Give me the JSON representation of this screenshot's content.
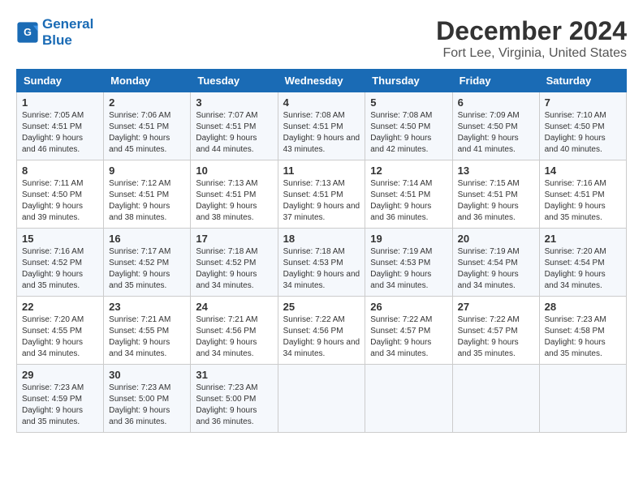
{
  "logo": {
    "line1": "General",
    "line2": "Blue"
  },
  "title": "December 2024",
  "location": "Fort Lee, Virginia, United States",
  "headers": [
    "Sunday",
    "Monday",
    "Tuesday",
    "Wednesday",
    "Thursday",
    "Friday",
    "Saturday"
  ],
  "weeks": [
    [
      {
        "day": "1",
        "sunrise": "7:05 AM",
        "sunset": "4:51 PM",
        "daylight": "9 hours and 46 minutes."
      },
      {
        "day": "2",
        "sunrise": "7:06 AM",
        "sunset": "4:51 PM",
        "daylight": "9 hours and 45 minutes."
      },
      {
        "day": "3",
        "sunrise": "7:07 AM",
        "sunset": "4:51 PM",
        "daylight": "9 hours and 44 minutes."
      },
      {
        "day": "4",
        "sunrise": "7:08 AM",
        "sunset": "4:51 PM",
        "daylight": "9 hours and 43 minutes."
      },
      {
        "day": "5",
        "sunrise": "7:08 AM",
        "sunset": "4:50 PM",
        "daylight": "9 hours and 42 minutes."
      },
      {
        "day": "6",
        "sunrise": "7:09 AM",
        "sunset": "4:50 PM",
        "daylight": "9 hours and 41 minutes."
      },
      {
        "day": "7",
        "sunrise": "7:10 AM",
        "sunset": "4:50 PM",
        "daylight": "9 hours and 40 minutes."
      }
    ],
    [
      {
        "day": "8",
        "sunrise": "7:11 AM",
        "sunset": "4:50 PM",
        "daylight": "9 hours and 39 minutes."
      },
      {
        "day": "9",
        "sunrise": "7:12 AM",
        "sunset": "4:51 PM",
        "daylight": "9 hours and 38 minutes."
      },
      {
        "day": "10",
        "sunrise": "7:13 AM",
        "sunset": "4:51 PM",
        "daylight": "9 hours and 38 minutes."
      },
      {
        "day": "11",
        "sunrise": "7:13 AM",
        "sunset": "4:51 PM",
        "daylight": "9 hours and 37 minutes."
      },
      {
        "day": "12",
        "sunrise": "7:14 AM",
        "sunset": "4:51 PM",
        "daylight": "9 hours and 36 minutes."
      },
      {
        "day": "13",
        "sunrise": "7:15 AM",
        "sunset": "4:51 PM",
        "daylight": "9 hours and 36 minutes."
      },
      {
        "day": "14",
        "sunrise": "7:16 AM",
        "sunset": "4:51 PM",
        "daylight": "9 hours and 35 minutes."
      }
    ],
    [
      {
        "day": "15",
        "sunrise": "7:16 AM",
        "sunset": "4:52 PM",
        "daylight": "9 hours and 35 minutes."
      },
      {
        "day": "16",
        "sunrise": "7:17 AM",
        "sunset": "4:52 PM",
        "daylight": "9 hours and 35 minutes."
      },
      {
        "day": "17",
        "sunrise": "7:18 AM",
        "sunset": "4:52 PM",
        "daylight": "9 hours and 34 minutes."
      },
      {
        "day": "18",
        "sunrise": "7:18 AM",
        "sunset": "4:53 PM",
        "daylight": "9 hours and 34 minutes."
      },
      {
        "day": "19",
        "sunrise": "7:19 AM",
        "sunset": "4:53 PM",
        "daylight": "9 hours and 34 minutes."
      },
      {
        "day": "20",
        "sunrise": "7:19 AM",
        "sunset": "4:54 PM",
        "daylight": "9 hours and 34 minutes."
      },
      {
        "day": "21",
        "sunrise": "7:20 AM",
        "sunset": "4:54 PM",
        "daylight": "9 hours and 34 minutes."
      }
    ],
    [
      {
        "day": "22",
        "sunrise": "7:20 AM",
        "sunset": "4:55 PM",
        "daylight": "9 hours and 34 minutes."
      },
      {
        "day": "23",
        "sunrise": "7:21 AM",
        "sunset": "4:55 PM",
        "daylight": "9 hours and 34 minutes."
      },
      {
        "day": "24",
        "sunrise": "7:21 AM",
        "sunset": "4:56 PM",
        "daylight": "9 hours and 34 minutes."
      },
      {
        "day": "25",
        "sunrise": "7:22 AM",
        "sunset": "4:56 PM",
        "daylight": "9 hours and 34 minutes."
      },
      {
        "day": "26",
        "sunrise": "7:22 AM",
        "sunset": "4:57 PM",
        "daylight": "9 hours and 34 minutes."
      },
      {
        "day": "27",
        "sunrise": "7:22 AM",
        "sunset": "4:57 PM",
        "daylight": "9 hours and 35 minutes."
      },
      {
        "day": "28",
        "sunrise": "7:23 AM",
        "sunset": "4:58 PM",
        "daylight": "9 hours and 35 minutes."
      }
    ],
    [
      {
        "day": "29",
        "sunrise": "7:23 AM",
        "sunset": "4:59 PM",
        "daylight": "9 hours and 35 minutes."
      },
      {
        "day": "30",
        "sunrise": "7:23 AM",
        "sunset": "5:00 PM",
        "daylight": "9 hours and 36 minutes."
      },
      {
        "day": "31",
        "sunrise": "7:23 AM",
        "sunset": "5:00 PM",
        "daylight": "9 hours and 36 minutes."
      },
      null,
      null,
      null,
      null
    ]
  ]
}
